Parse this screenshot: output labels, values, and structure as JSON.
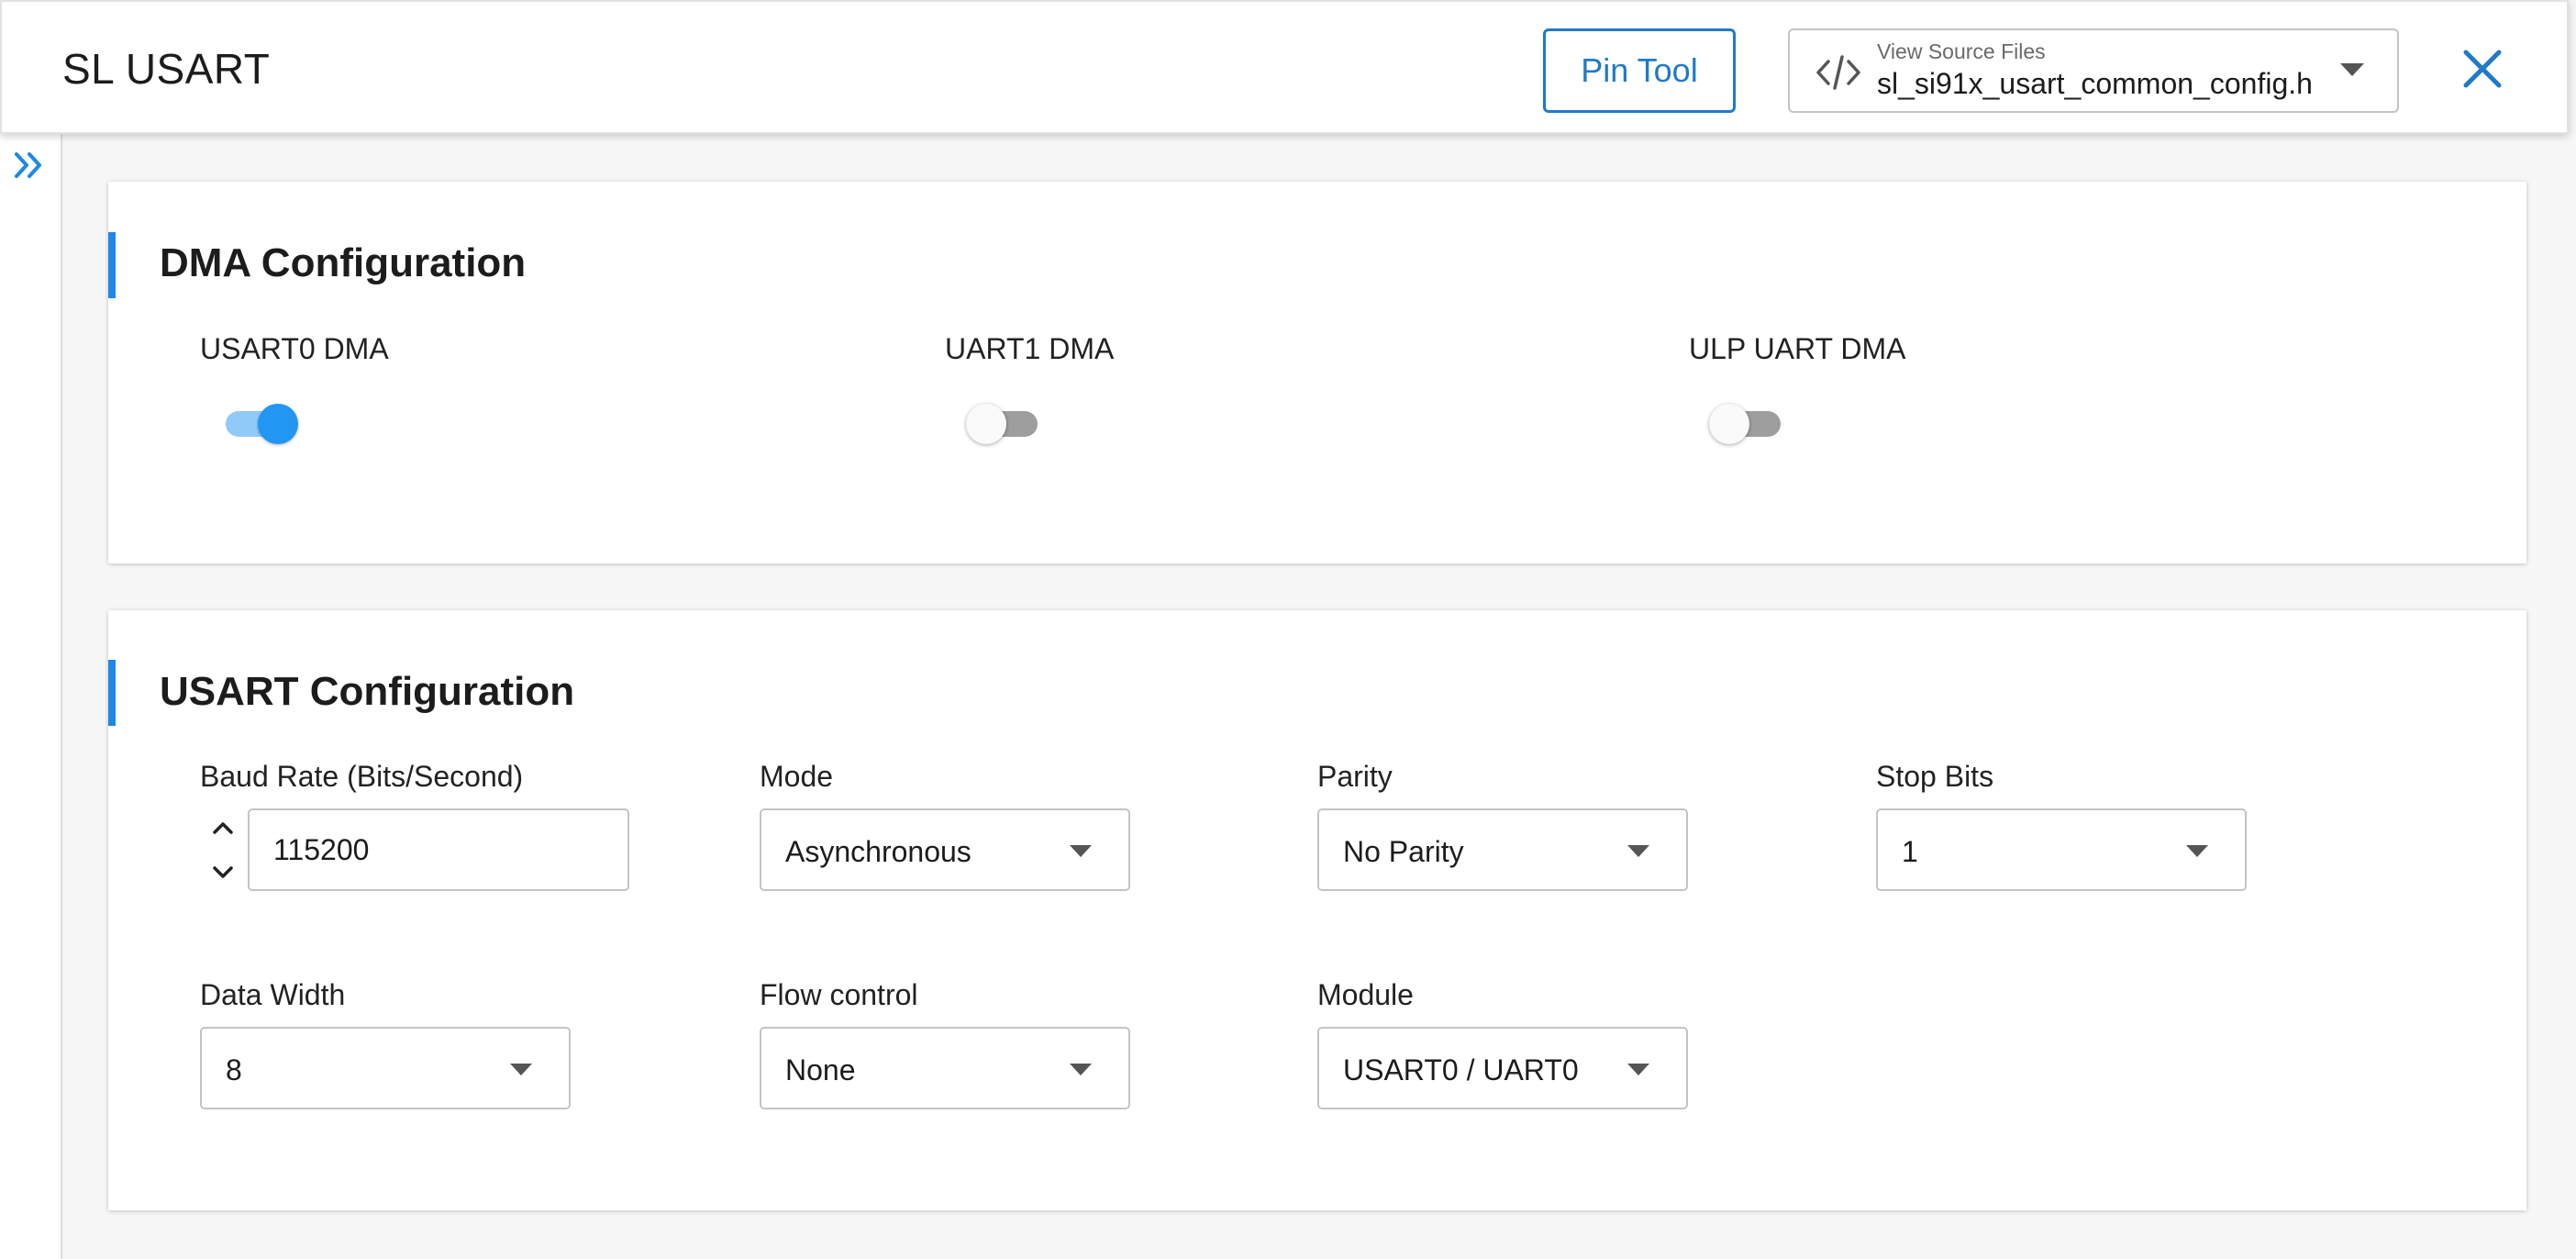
{
  "header": {
    "title": "SL USART",
    "pin_tool_label": "Pin Tool",
    "source_files": {
      "label": "View Source Files",
      "value": "sl_si91x_usart_common_config.h"
    }
  },
  "colors": {
    "accent": "#1e88e5",
    "toggle_on_thumb": "#2196f3",
    "toggle_on_track": "#90caf9",
    "toggle_off_track": "#9e9e9e"
  },
  "icons": {
    "header": [
      "code-icon",
      "chevron-down-icon",
      "close-icon"
    ],
    "rail": "double-chevron-right-icon",
    "stepper": [
      "chevron-up-icon",
      "chevron-down-icon"
    ]
  },
  "dma": {
    "title": "DMA Configuration",
    "toggles": [
      {
        "label": "USART0 DMA",
        "on": true
      },
      {
        "label": "UART1 DMA",
        "on": false
      },
      {
        "label": "ULP UART DMA",
        "on": false
      }
    ]
  },
  "usart": {
    "title": "USART Configuration",
    "baud_rate": {
      "label": "Baud Rate (Bits/Second)",
      "value": "115200"
    },
    "mode": {
      "label": "Mode",
      "value": "Asynchronous"
    },
    "parity": {
      "label": "Parity",
      "value": "No Parity"
    },
    "stop_bits": {
      "label": "Stop Bits",
      "value": "1"
    },
    "data_width": {
      "label": "Data Width",
      "value": "8"
    },
    "flow_control": {
      "label": "Flow control",
      "value": "None"
    },
    "module": {
      "label": "Module",
      "value": "USART0 / UART0"
    }
  }
}
